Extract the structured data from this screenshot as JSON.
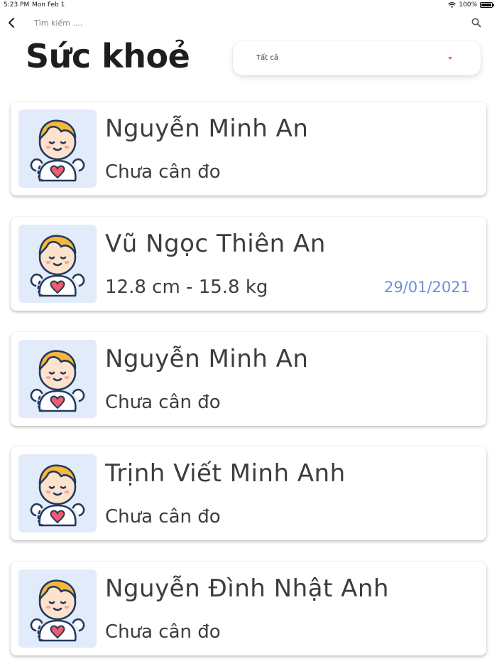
{
  "status_bar": {
    "time": "5:23 PM",
    "date": "Mon Feb 1",
    "battery": "100%"
  },
  "search": {
    "placeholder": "Tìm kiếm ...."
  },
  "header": {
    "title": "Sức khoẻ"
  },
  "filter": {
    "selected": "Tất cả",
    "caret_color": "#f26a3c"
  },
  "icons": {
    "back": "chevron-left-icon",
    "search": "search-icon",
    "avatar": "baby-avatar-icon",
    "wifi": "wifi-icon",
    "battery": "battery-icon"
  },
  "colors": {
    "date_accent": "#6b8fd6",
    "avatar_background": "#e2ebfa"
  },
  "children": [
    {
      "name": "Nguyễn Minh An",
      "status": "Chưa cân đo",
      "date": ""
    },
    {
      "name": "Vũ Ngọc Thiên An",
      "status": "12.8 cm - 15.8 kg",
      "date": "29/01/2021"
    },
    {
      "name": "Nguyễn Minh An",
      "status": "Chưa cân đo",
      "date": ""
    },
    {
      "name": "Trịnh Viết Minh Anh",
      "status": "Chưa cân đo",
      "date": ""
    },
    {
      "name": "Nguyễn Đình Nhật Anh",
      "status": "Chưa cân đo",
      "date": ""
    }
  ]
}
